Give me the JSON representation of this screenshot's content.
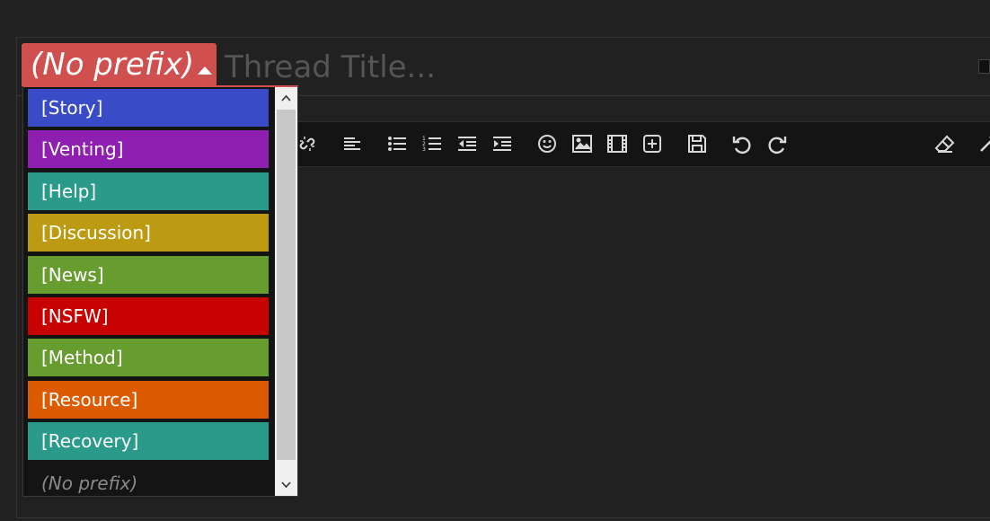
{
  "prefix": {
    "selected_label": "(No prefix)",
    "caret_icon": "caret-up-icon"
  },
  "title_input": {
    "placeholder": "Thread Title...",
    "value": ""
  },
  "dropdown": {
    "options": [
      {
        "label": "[Story]",
        "color": "#3a4bc7"
      },
      {
        "label": "[Venting]",
        "color": "#8e1fb0"
      },
      {
        "label": "[Help]",
        "color": "#2a9a8b"
      },
      {
        "label": "[Discussion]",
        "color": "#bc9b13"
      },
      {
        "label": "[News]",
        "color": "#679c2f"
      },
      {
        "label": "[NSFW]",
        "color": "#c80101"
      },
      {
        "label": "[Method]",
        "color": "#679c2f"
      },
      {
        "label": "[Resource]",
        "color": "#dd5b00"
      },
      {
        "label": "[Recovery]",
        "color": "#2a9a8b"
      }
    ],
    "no_prefix_label": "(No prefix)"
  },
  "toolbar": {
    "icons": [
      "unlink-icon",
      "align-left-icon",
      "bullet-list-icon",
      "numbered-list-icon",
      "outdent-icon",
      "indent-icon",
      "smiley-icon",
      "image-icon",
      "video-icon",
      "insert-icon",
      "save-draft-icon",
      "undo-icon",
      "redo-icon",
      "remove-formatting-icon",
      "toggle-bbcode-icon"
    ]
  },
  "colors": {
    "prefix_accent": "#d0504f",
    "background": "#222222",
    "toolbar_bg": "#141414"
  }
}
